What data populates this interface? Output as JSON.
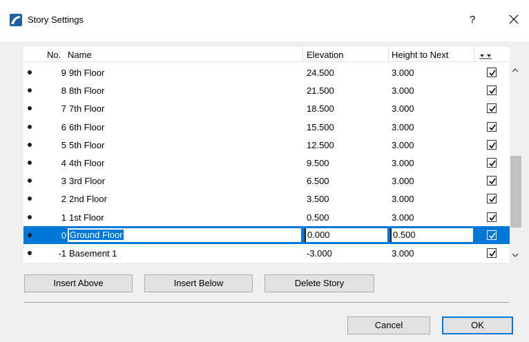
{
  "window": {
    "title": "Story Settings",
    "help_label": "?"
  },
  "table": {
    "headers": {
      "no": "No.",
      "name": "Name",
      "elevation": "Elevation",
      "height_to_next": "Height to Next"
    },
    "rows": [
      {
        "no": "9",
        "name": "9th Floor",
        "elevation": "24.500",
        "height": "3.000",
        "checked": true
      },
      {
        "no": "8",
        "name": "8th Floor",
        "elevation": "21.500",
        "height": "3.000",
        "checked": true
      },
      {
        "no": "7",
        "name": "7th Floor",
        "elevation": "18.500",
        "height": "3.000",
        "checked": true
      },
      {
        "no": "6",
        "name": "6th Floor",
        "elevation": "15.500",
        "height": "3.000",
        "checked": true
      },
      {
        "no": "5",
        "name": "5th Floor",
        "elevation": "12.500",
        "height": "3.000",
        "checked": true
      },
      {
        "no": "4",
        "name": "4th Floor",
        "elevation": "9.500",
        "height": "3.000",
        "checked": true
      },
      {
        "no": "3",
        "name": "3rd Floor",
        "elevation": "6.500",
        "height": "3.000",
        "checked": true
      },
      {
        "no": "2",
        "name": "2nd Floor",
        "elevation": "3.500",
        "height": "3.000",
        "checked": true
      },
      {
        "no": "1",
        "name": "1st Floor",
        "elevation": "0.500",
        "height": "3.000",
        "checked": true
      },
      {
        "no": "0",
        "name": "Ground Floor",
        "elevation": "0.000",
        "height": "0.500",
        "checked": true,
        "selected": true
      },
      {
        "no": "-1",
        "name": "Basement 1",
        "elevation": "-3.000",
        "height": "3.000",
        "checked": true
      }
    ]
  },
  "buttons": {
    "insert_above": "Insert Above",
    "insert_below": "Insert Below",
    "delete_story": "Delete Story",
    "cancel": "Cancel",
    "ok": "OK"
  },
  "colors": {
    "selection": "#0078d7",
    "app_icon": "#1f5fa8"
  }
}
